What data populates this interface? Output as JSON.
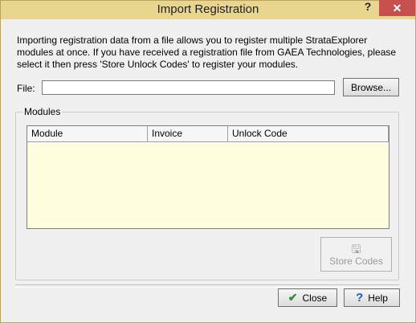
{
  "window": {
    "title": "Import Registration",
    "help_glyph": "?",
    "close_glyph": "✕"
  },
  "intro": "Importing registration data from a file allows you to register multiple StrataExplorer modules at once. If you have received a registration file from GAEA Technologies, please select it then press 'Store Unlock Codes' to register your modules.",
  "file": {
    "label": "File:",
    "value": "",
    "browse_label": "Browse..."
  },
  "modules": {
    "group_label": "Modules",
    "columns": [
      "Module",
      "Invoice",
      "Unlock Code"
    ],
    "rows": []
  },
  "store_codes": {
    "label": "Store Codes",
    "icon": "save-disk-icon"
  },
  "buttons": {
    "close": "Close",
    "help": "Help"
  }
}
